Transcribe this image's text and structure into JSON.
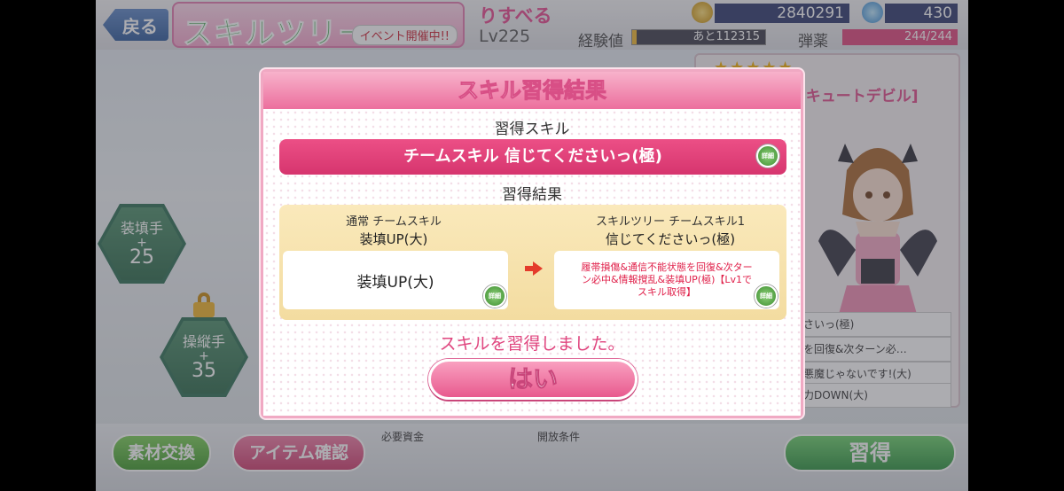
{
  "topbar": {
    "back_label": "戻る",
    "title": "スキルツリー",
    "event_badge": "イベント開催中!!",
    "character_name": "りすべる",
    "level": "Lv225",
    "exp_label": "経験値",
    "exp_remaining": "あと112315",
    "exp_progress": 0.03,
    "money": "2840291",
    "gems": "430",
    "ammo_label": "弾薬",
    "ammo": "244/244"
  },
  "tree": {
    "nodes": [
      {
        "role": "装填手",
        "plus": "+",
        "value": "25"
      },
      {
        "role": "操縦手",
        "plus": "+",
        "value": "35"
      }
    ]
  },
  "char_panel": {
    "stars": "★★★★★",
    "title": "[キュートデビル]",
    "skill_rows": [
      "ださいっ(極)",
      "態を回復&次ターン必…",
      "い悪魔じゃないです!(大)",
      "動力DOWN(大)"
    ]
  },
  "bottombar": {
    "exchange_label": "素材交換",
    "item_label": "アイテム確認",
    "required_funds_label": "必要資金",
    "release_condition_label": "開放条件",
    "learn_label": "習得"
  },
  "modal": {
    "title": "スキル習得結果",
    "acquired_label": "習得スキル",
    "acquired_skill": "チームスキル 信じてくださいっ(極)",
    "detail_label": "詳細",
    "result_label": "習得結果",
    "before": {
      "category": "通常 チームスキル",
      "name": "装填UP(大)",
      "description": "装填UP(大)"
    },
    "after": {
      "category": "スキルツリー チームスキル1",
      "name": "信じてくださいっ(極)",
      "description": "履帯損傷&通信不能状態を回復&次ターン必中&情報撹乱&装填UP(極)【Lv1でスキル取得】"
    },
    "message": "スキルを習得しました。",
    "yes_label": "はい"
  },
  "colors": {
    "accent_pink": "#e85a8e",
    "accent_green": "#3f9a2c",
    "description_red": "#e0204a"
  }
}
